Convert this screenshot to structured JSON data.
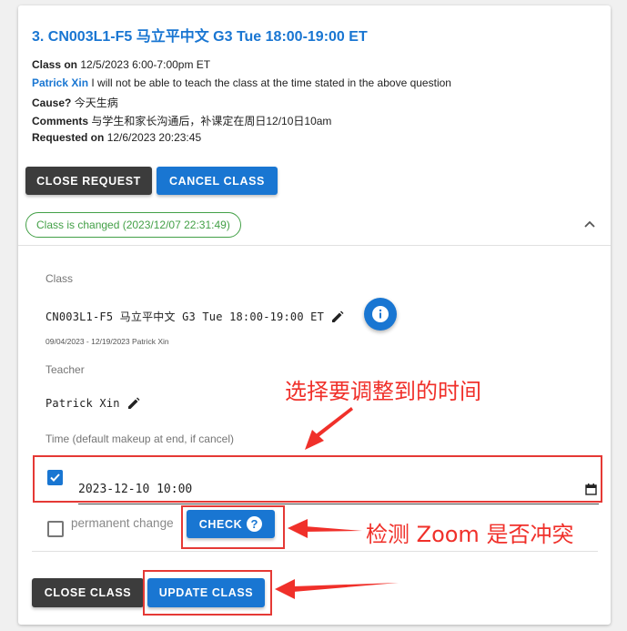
{
  "request": {
    "title": "3. CN003L1-F5 马立平中文 G3 Tue 18:00-19:00 ET",
    "class_on_label": "Class on",
    "class_on_value": "12/5/2023 6:00-7:00pm ET",
    "requester_name": "Patrick Xin",
    "requester_message": "I will not be able to teach the class at the time stated in the above question",
    "cause_label": "Cause?",
    "cause_value": "今天生病",
    "comments_label": "Comments",
    "comments_value": "与学生和家长沟通后，补课定在周日12/10日10am",
    "requested_on_label": "Requested on",
    "requested_on_value": "12/6/2023 20:23:45"
  },
  "actions": {
    "close_request": "CLOSE REQUEST",
    "cancel_class": "CANCEL CLASS"
  },
  "status_chip": "Class is changed (2023/12/07 22:31:49)",
  "form": {
    "class_label": "Class",
    "class_value": "CN003L1-F5 马立平中文 G3 Tue 18:00-19:00 ET",
    "class_subtext": "09/04/2023 - 12/19/2023 Patrick Xin",
    "teacher_label": "Teacher",
    "teacher_value": "Patrick Xin",
    "time_label": "Time (default makeup at end, if cancel)",
    "datetime_value": "2023-12-10 10:00",
    "permanent_change_label": "permanent change",
    "check_label": "CHECK"
  },
  "footer": {
    "close_class": "CLOSE CLASS",
    "update_class": "UPDATE CLASS"
  },
  "annotations": {
    "choose_time": "选择要调整到的时间",
    "check_zoom": "检测 Zoom 是否冲突"
  },
  "colors": {
    "primary": "#1976d2",
    "dark_button": "#3c3c3c",
    "success": "#43a047",
    "annotation_red": "#e53935"
  }
}
